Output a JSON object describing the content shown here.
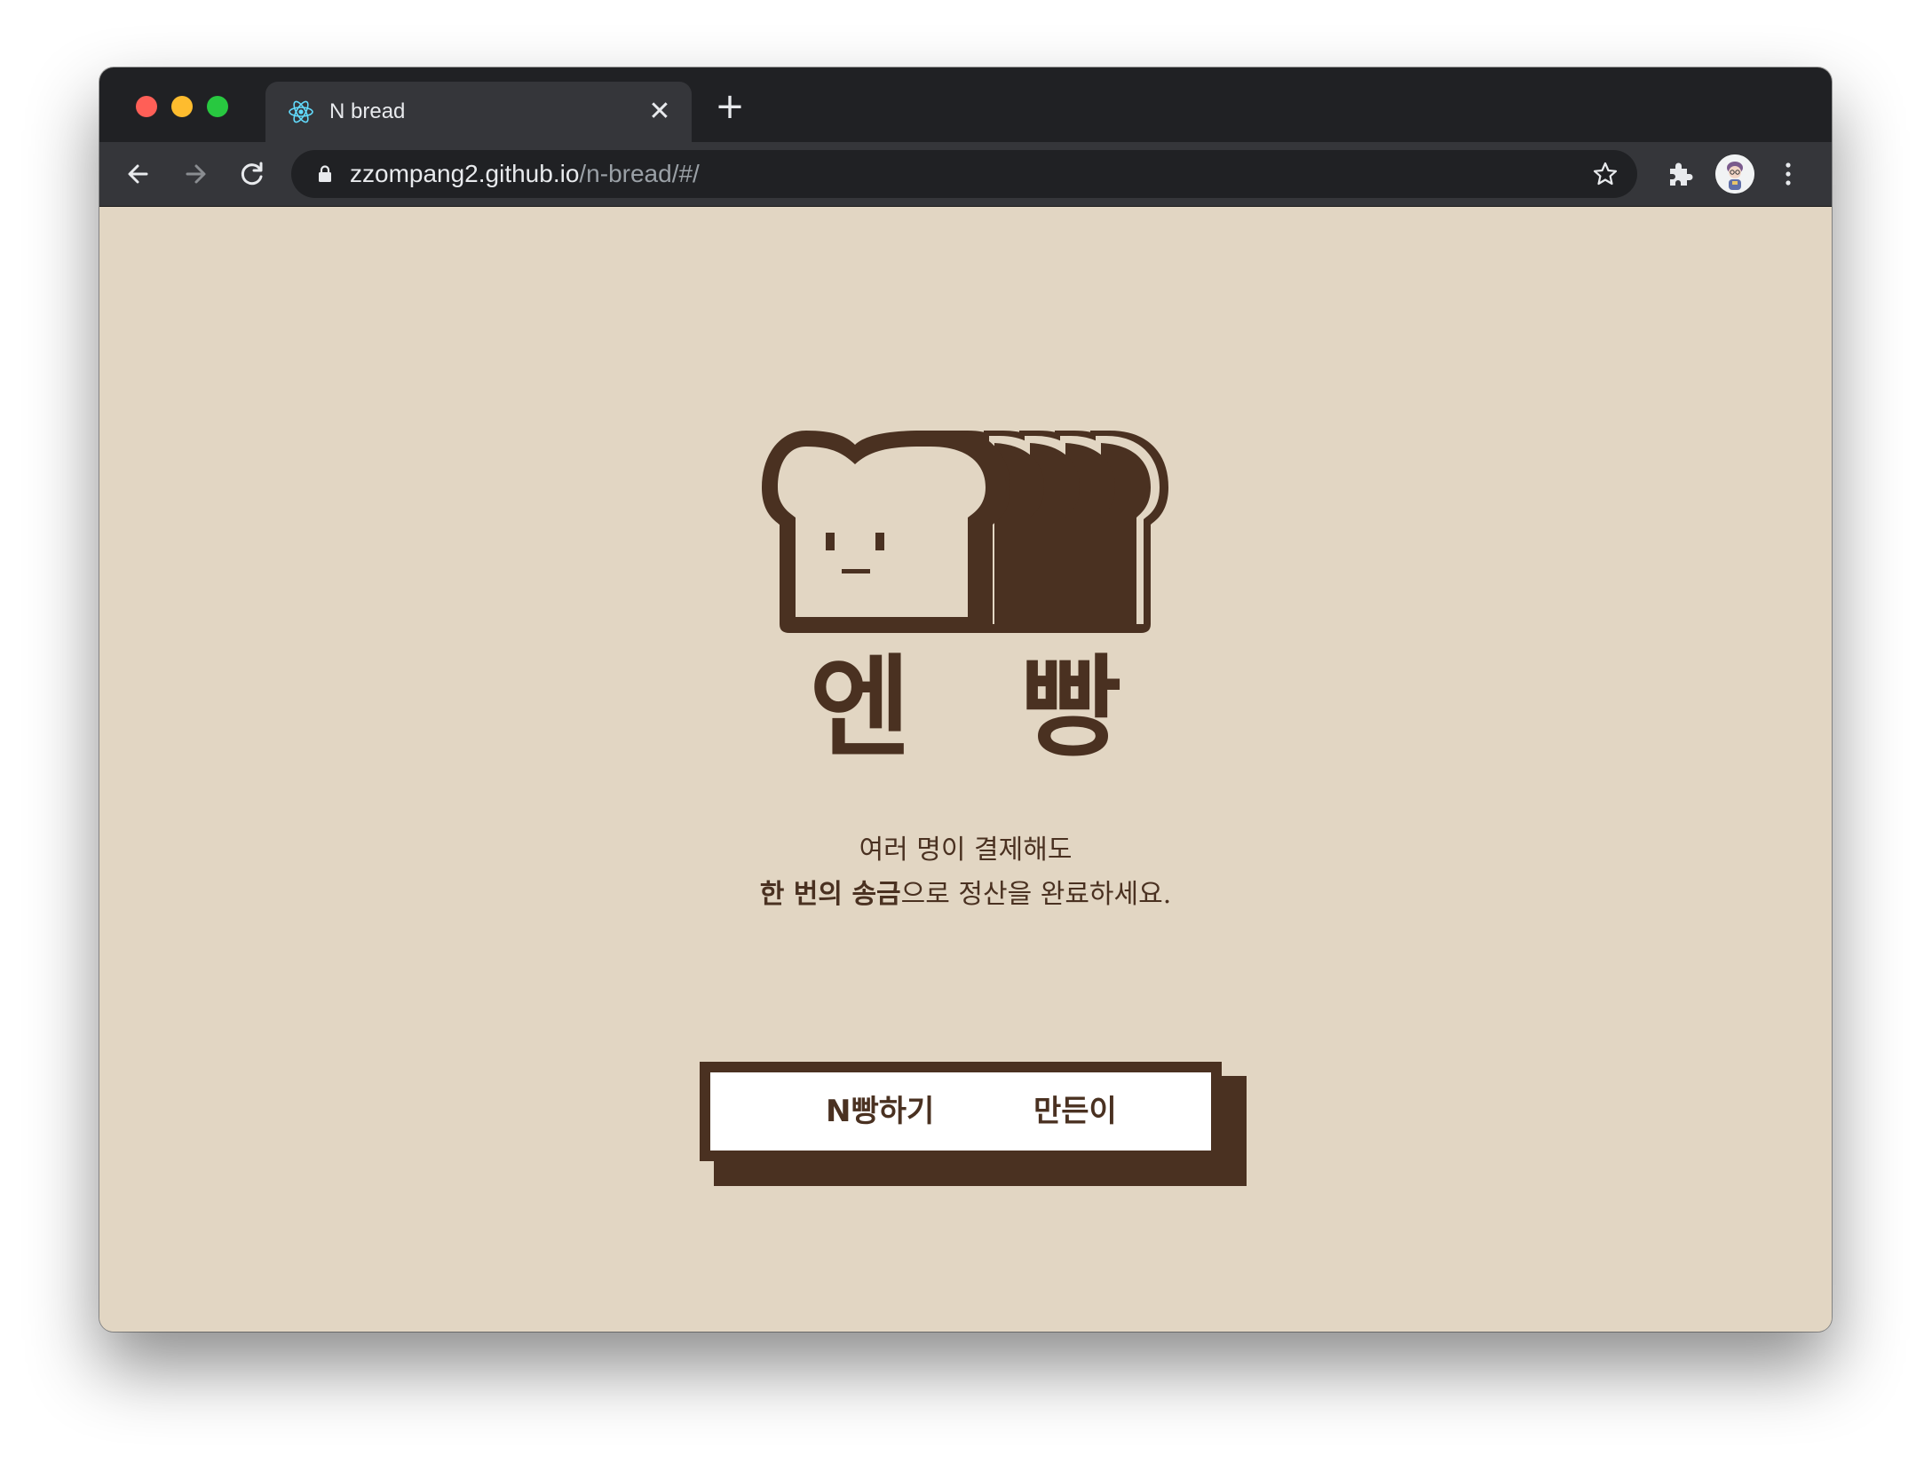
{
  "browser": {
    "tab": {
      "title": "N bread",
      "favicon": "react-atom-icon",
      "close_label": "✕"
    },
    "new_tab_label": "+",
    "address": {
      "host": "zzompang2.github.io",
      "path": "/n-bread/#/"
    }
  },
  "page": {
    "brand_title": "엔 빵",
    "tagline": {
      "line1": "여러 명이 결제해도",
      "line2_bold": "한 번의 송금",
      "line2_rest": "으로 정산을 완료하세요."
    },
    "menu": {
      "items": [
        {
          "label": "N빵하기"
        },
        {
          "label": "만든이"
        }
      ]
    }
  },
  "colors": {
    "background": "#e2d6c3",
    "brand_brown": "#4a3121",
    "chrome_dark": "#202124",
    "chrome_mid": "#35363a"
  }
}
